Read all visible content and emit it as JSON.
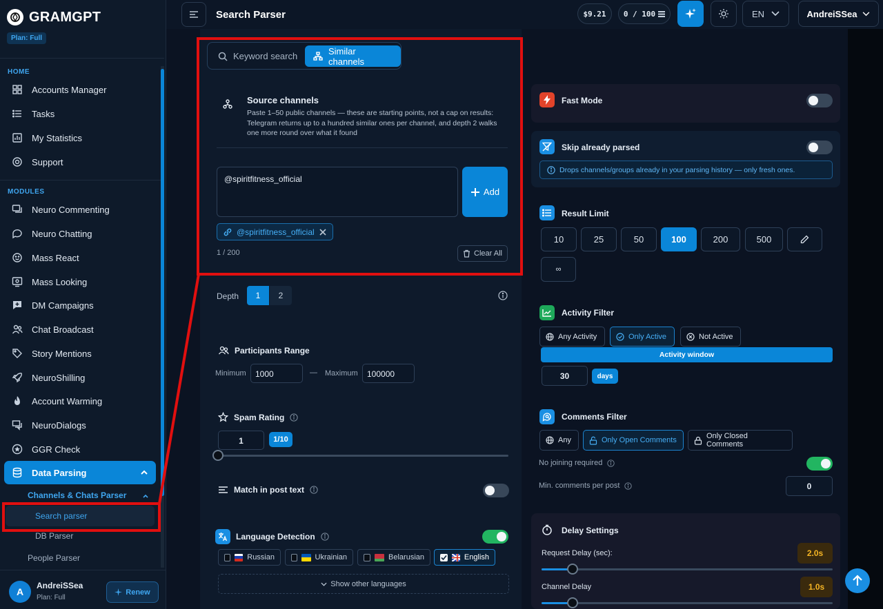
{
  "brand": {
    "name": "GRAMGPT",
    "plan_badge": "Plan: Full"
  },
  "sidebar": {
    "home_label": "HOME",
    "home_items": [
      {
        "label": "Accounts Manager",
        "icon": "grid-icon"
      },
      {
        "label": "Tasks",
        "icon": "list-icon"
      },
      {
        "label": "My Statistics",
        "icon": "chart-icon"
      },
      {
        "label": "Support",
        "icon": "lifebuoy-icon"
      }
    ],
    "modules_label": "MODULES",
    "module_items": [
      {
        "label": "Neuro Commenting",
        "icon": "comments-icon"
      },
      {
        "label": "Neuro Chatting",
        "icon": "chat-icon"
      },
      {
        "label": "Mass React",
        "icon": "smile-icon"
      },
      {
        "label": "Mass Looking",
        "icon": "eye-icon"
      },
      {
        "label": "DM Campaigns",
        "icon": "dm-icon"
      },
      {
        "label": "Chat Broadcast",
        "icon": "users-icon"
      },
      {
        "label": "Story Mentions",
        "icon": "tag-icon"
      },
      {
        "label": "NeuroShilling",
        "icon": "rocket-icon"
      },
      {
        "label": "Account Warming",
        "icon": "flame-icon"
      },
      {
        "label": "NeuroDialogs",
        "icon": "dialogs-icon"
      },
      {
        "label": "GGR Check",
        "icon": "star-icon"
      },
      {
        "label": "Data Parsing",
        "icon": "database-icon"
      }
    ],
    "sub_group": "Channels & Chats Parser",
    "sub_active": "Search parser",
    "sub_db": "DB Parser",
    "sub_people": "People Parser",
    "user": {
      "initial": "A",
      "name": "AndreiSSea",
      "plan": "Plan: Full",
      "renew": "Renew"
    }
  },
  "topbar": {
    "title": "Search Parser",
    "balance": "$9.21",
    "quota": "0 / 100",
    "lang": "EN",
    "user": "AndreiSSea"
  },
  "search": {
    "tab_keyword": "Keyword search",
    "tab_similar": "Similar channels",
    "source_title": "Source channels",
    "source_desc": "Paste 1–50 public channels — these are starting points, not a cap on results: Telegram returns up to a hundred similar ones per channel, and depth 2 walks one more round over what it found",
    "input_value": "@spiritfitness_official",
    "add_label": "Add",
    "chip": "@spiritfitness_official",
    "count": "1 / 200",
    "clear_all": "Clear All",
    "depth_label": "Depth",
    "depth_options": [
      "1",
      "2"
    ],
    "depth_selected": "1",
    "participants_title": "Participants Range",
    "min_label": "Minimum",
    "min_value": "1000",
    "dash": "—",
    "max_label": "Maximum",
    "max_value": "100000",
    "spam_title": "Spam Rating",
    "spam_value": "1",
    "spam_badge": "1/10",
    "match_title": "Match in post text",
    "match_on": false,
    "lang_title": "Language Detection",
    "lang_on": true,
    "languages": [
      {
        "label": "Russian",
        "checked": false
      },
      {
        "label": "Ukrainian",
        "checked": false
      },
      {
        "label": "Belarusian",
        "checked": false
      },
      {
        "label": "English",
        "checked": true
      }
    ],
    "show_other": "Show other languages"
  },
  "settings": {
    "fast_mode": "Fast Mode",
    "fast_mode_on": false,
    "skip_parsed": "Skip already parsed",
    "skip_parsed_on": false,
    "skip_info": "Drops channels/groups already in your parsing history — only fresh ones.",
    "result_limit": "Result Limit",
    "limits": [
      "10",
      "25",
      "50",
      "100",
      "200",
      "500"
    ],
    "limit_selected": "100",
    "limit_infinite": "∞",
    "activity_filter": "Activity Filter",
    "activity_options": [
      "Any Activity",
      "Only Active",
      "Not Active"
    ],
    "activity_selected": "Only Active",
    "activity_window": "Activity window",
    "activity_days": "30",
    "days_label": "days",
    "comments_filter": "Comments Filter",
    "comment_options": [
      "Any",
      "Only Open Comments",
      "Only Closed Comments"
    ],
    "comment_selected": "Only Open Comments",
    "no_joining": "No joining required",
    "no_joining_on": true,
    "min_comments": "Min. comments per post",
    "min_comments_value": "0",
    "delay_title": "Delay Settings",
    "request_delay": "Request Delay (sec):",
    "request_delay_value": "2.0s",
    "channel_delay": "Channel Delay",
    "channel_delay_value": "1.0s"
  },
  "colors": {
    "accent": "#0a86d8",
    "highlight": "#e10f0f",
    "success": "#22b561",
    "warning": "#f4b424"
  }
}
